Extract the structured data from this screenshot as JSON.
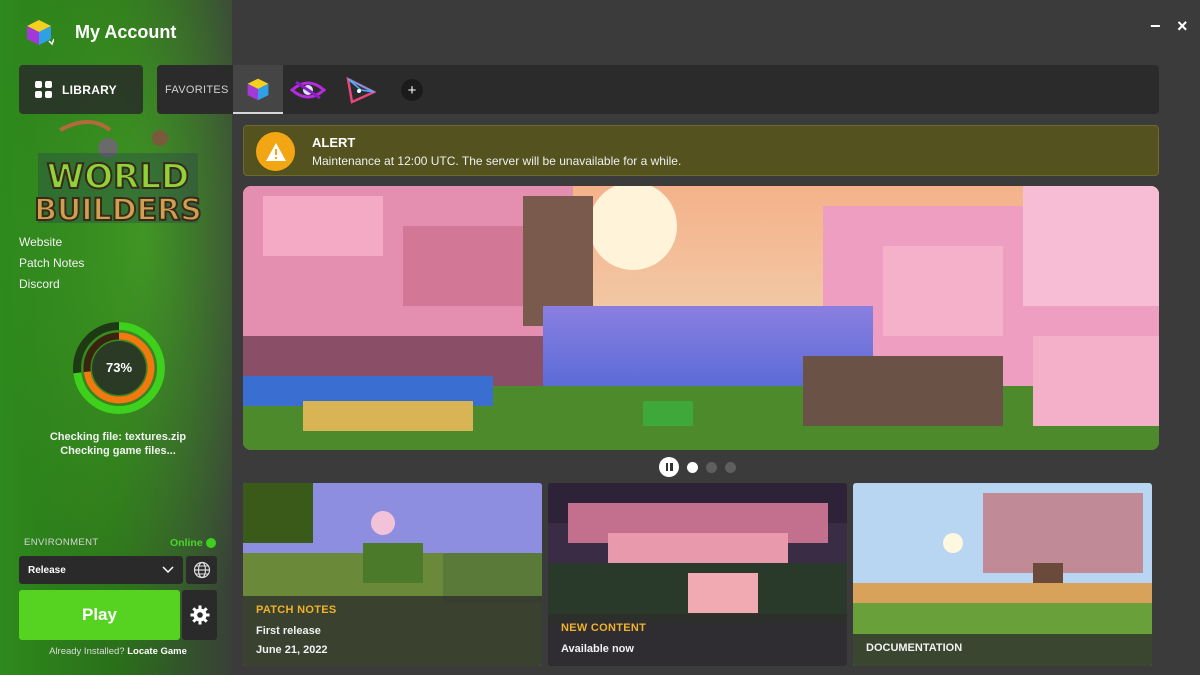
{
  "app": {
    "title": "My Account",
    "minimize_label": "−",
    "close_label": "×"
  },
  "library": {
    "label": "LIBRARY"
  },
  "favorites": {
    "label": "FAVORITES",
    "items": [
      {
        "icon": "cube-game-icon",
        "active": true
      },
      {
        "icon": "eye-game-icon",
        "active": false
      },
      {
        "icon": "triangle-game-icon",
        "active": false
      }
    ],
    "add_label": "+"
  },
  "alert": {
    "title": "ALERT",
    "message": "Maintenance at 12:00 UTC. The server will be unavailable for a while."
  },
  "game": {
    "logo_line1": "WORLD",
    "logo_line2": "BUILDERS"
  },
  "links": [
    "Website",
    "Patch Notes",
    "Discord"
  ],
  "progress": {
    "percent": 73,
    "label": "73%",
    "file_status": "Checking file: textures.zip",
    "status": "Checking game files..."
  },
  "carousel": {
    "slides": 3,
    "active": 0
  },
  "news": [
    {
      "category": "PATCH NOTES",
      "title": "First release",
      "date": "June 21, 2022"
    },
    {
      "category": "NEW CONTENT",
      "title": "Available now"
    },
    {
      "category": "DOCUMENTATION"
    }
  ],
  "environment": {
    "label": "ENVIRONMENT",
    "status": "Online",
    "selected": "Release"
  },
  "actions": {
    "play_label": "Play",
    "installed_prefix": "Already Installed?",
    "locate_label": "Locate Game"
  },
  "colors": {
    "accent_green": "#55d320",
    "alert_orange": "#f2a614",
    "news_category": "#f0b22a"
  }
}
